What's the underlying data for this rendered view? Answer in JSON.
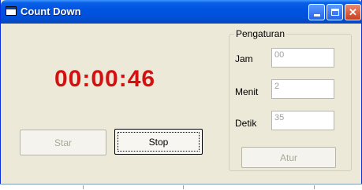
{
  "window": {
    "title": "Count Down",
    "minimize_label": "",
    "maximize_label": "",
    "close_label": "✕"
  },
  "timer": {
    "display": "00:00:46",
    "color": "#D41010"
  },
  "buttons": {
    "start_label": "Star",
    "stop_label": "Stop"
  },
  "settings": {
    "group_label": "Pengaturan",
    "hours_label": "Jam",
    "hours_value": "00",
    "minutes_label": "Menit",
    "minutes_value": "2",
    "seconds_label": "Detik",
    "seconds_value": "35",
    "set_label": "Atur"
  },
  "icons": {
    "app": "app-window-icon",
    "minimize": "minimize-icon",
    "maximize": "maximize-icon",
    "close": "close-icon"
  }
}
